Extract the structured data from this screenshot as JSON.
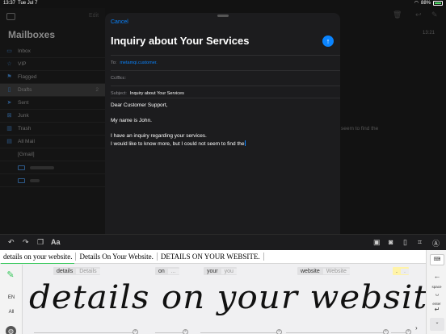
{
  "status": {
    "time": "13:37",
    "date": "Tue Jul 7",
    "battery": "88%",
    "battery_level": 0.88
  },
  "sidebar": {
    "edit_label": "Edit",
    "title": "Mailboxes",
    "items": [
      {
        "label": "Inbox",
        "icon": "tray-icon",
        "count": ""
      },
      {
        "label": "VIP",
        "icon": "star-icon",
        "count": ""
      },
      {
        "label": "Flagged",
        "icon": "flag-icon",
        "count": ""
      },
      {
        "label": "Drafts",
        "icon": "document-icon",
        "count": "2"
      },
      {
        "label": "Sent",
        "icon": "paperplane-icon",
        "count": ""
      },
      {
        "label": "Junk",
        "icon": "junk-icon",
        "count": ""
      },
      {
        "label": "Trash",
        "icon": "trash-icon",
        "count": ""
      },
      {
        "label": "All Mail",
        "icon": "tray-full-icon",
        "count": ""
      },
      {
        "label": "[Gmail]",
        "icon": "",
        "count": ""
      }
    ]
  },
  "rightpane": {
    "time": "13:21",
    "snippet": "seem to find the"
  },
  "compose": {
    "cancel_label": "Cancel",
    "title": "Inquiry about Your Services",
    "to_label": "To:",
    "to_value": "metamqi.customer.",
    "cc_label": "Cc/Bcc:",
    "subject_label": "Subject:",
    "subject_value": "Inquiry about Your Services",
    "body": {
      "line1": "Dear Customer Support,",
      "line2": "My name is John.",
      "line3": "I have an inquiry regarding your services.",
      "line4": "I would like to know more, but I could not seem to find the"
    }
  },
  "toolbar": {
    "format_label": "Aa"
  },
  "keyboard": {
    "candidates": [
      "details on your website.",
      "Details On Your Website.",
      "DETAILS ON YOUR WEBSITE."
    ],
    "segments": [
      {
        "main": "details",
        "alt": "Details"
      },
      {
        "main": "on",
        "alt": "..."
      },
      {
        "main": "your",
        "alt": "you"
      },
      {
        "main": "website",
        "alt": "Website"
      },
      {
        "main": ".",
        "alt": "."
      }
    ],
    "ink_text": "details on your website.",
    "lang_en": "EN",
    "lang_all": "All",
    "space_label": "space",
    "enter_label": "enter"
  },
  "colors": {
    "accent": "#0a84ff",
    "ink_green": "#34c759",
    "sheet_bg": "#1c1c1e"
  }
}
